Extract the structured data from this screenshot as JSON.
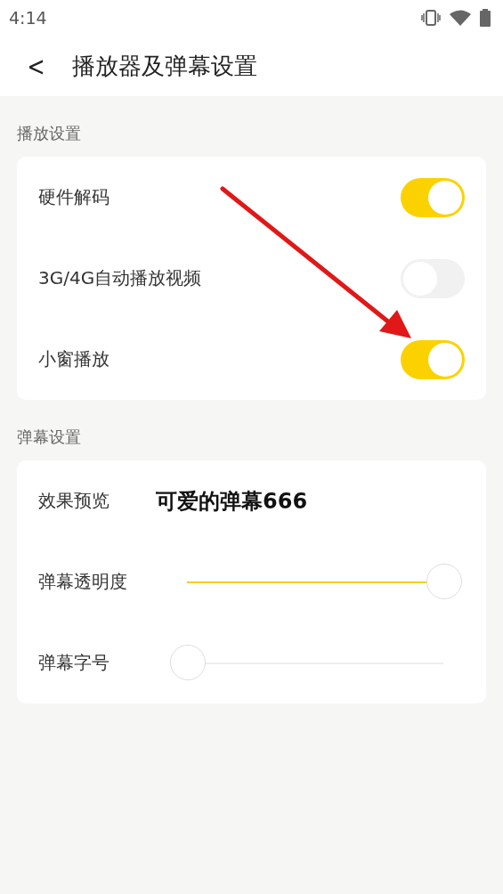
{
  "status_bar": {
    "time": "4:14"
  },
  "header": {
    "back": "<",
    "title": "播放器及弹幕设置"
  },
  "sections": [
    {
      "title": "播放设置",
      "rows": [
        {
          "kind": "toggle",
          "label": "硬件解码",
          "on": true
        },
        {
          "kind": "toggle",
          "label": "3G/4G自动播放视频",
          "on": false
        },
        {
          "kind": "toggle",
          "label": "小窗播放",
          "on": true
        }
      ]
    },
    {
      "title": "弹幕设置",
      "rows": [
        {
          "kind": "preview",
          "label": "效果预览",
          "value": "可爱的弹幕666"
        },
        {
          "kind": "slider",
          "label": "弹幕透明度",
          "level": 1
        },
        {
          "kind": "slider",
          "label": "弹幕字号",
          "level": 0
        }
      ]
    }
  ]
}
